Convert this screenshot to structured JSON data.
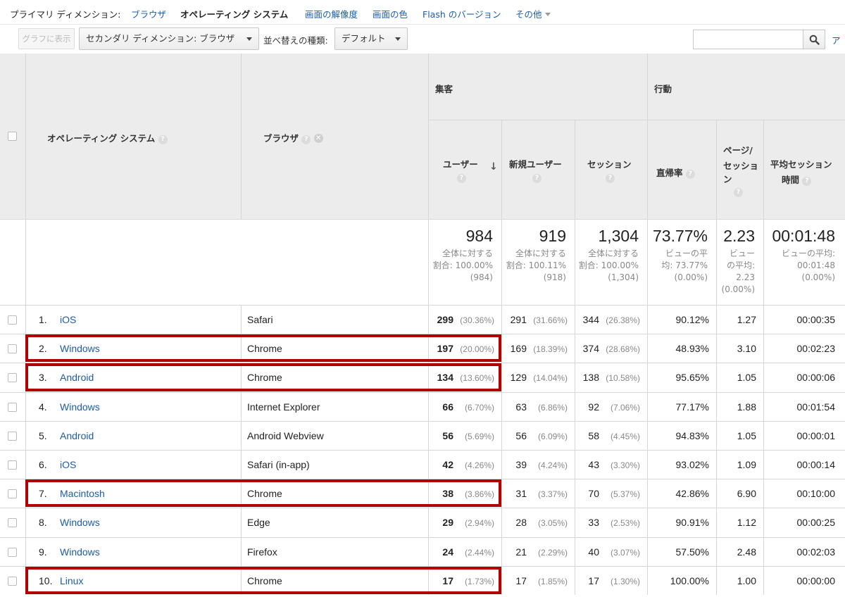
{
  "dimension_bar": {
    "label": "プライマリ ディメンション:",
    "options": [
      "ブラウザ",
      "オペレーティング システム",
      "画面の解像度",
      "画面の色",
      "Flash のバージョン",
      "その他"
    ],
    "active": "オペレーティング システム"
  },
  "toolbar": {
    "plot_button": "グラフに表示",
    "secondary_dimension": "セカンダリ ディメンション: ブラウザ",
    "sort_label": "並べ替えの種類:",
    "sort_value": "デフォルト",
    "search_value": "",
    "advanced_link": "ア"
  },
  "table": {
    "headers": {
      "os": "オペレーティング システム",
      "browser": "ブラウザ",
      "acquisition": "集客",
      "behavior": "行動",
      "users": "ユーザー",
      "new_users": "新規ユーザー",
      "sessions": "セッション",
      "bounce_rate": "直帰率",
      "pages_per_session_1": "ページ/",
      "pages_per_session_2": "セッション",
      "avg_session_1": "平均セッション",
      "avg_session_2": "時間",
      "help_glyph": "?",
      "remove_glyph": "✕",
      "sort_glyph": "↓"
    },
    "summary": {
      "users": {
        "value": "984",
        "l1": "全体に対する",
        "l2": "割合: 100.00%",
        "l3": "(984)"
      },
      "new_users": {
        "value": "919",
        "l1": "全体に対する",
        "l2": "割合: 100.11%",
        "l3": "(918)"
      },
      "sessions": {
        "value": "1,304",
        "l1": "全体に対する",
        "l2": "割合: 100.00%",
        "l3": "(1,304)"
      },
      "bounce_rate": {
        "value": "73.77%",
        "l1": "ビューの平",
        "l2": "均: 73.77%",
        "l3": "(0.00%)"
      },
      "pages": {
        "value": "2.23",
        "l1": "ビュー",
        "l2": "の平均:",
        "l3": "2.23",
        "l4": "(0.00%)"
      },
      "avg_duration": {
        "value": "00:01:48",
        "l1": "ビューの平均:",
        "l2": "00:01:48",
        "l3": "(0.00%)"
      }
    },
    "rows": [
      {
        "idx": "1.",
        "os": "iOS",
        "browser": "Safari",
        "users": "299",
        "users_pct": "(30.36%)",
        "new_users": "291",
        "new_users_pct": "(31.66%)",
        "sessions": "344",
        "sessions_pct": "(26.38%)",
        "bounce": "90.12%",
        "pages": "1.27",
        "duration": "00:00:35"
      },
      {
        "idx": "2.",
        "os": "Windows",
        "browser": "Chrome",
        "users": "197",
        "users_pct": "(20.00%)",
        "new_users": "169",
        "new_users_pct": "(18.39%)",
        "sessions": "374",
        "sessions_pct": "(28.68%)",
        "bounce": "48.93%",
        "pages": "3.10",
        "duration": "00:02:23"
      },
      {
        "idx": "3.",
        "os": "Android",
        "browser": "Chrome",
        "users": "134",
        "users_pct": "(13.60%)",
        "new_users": "129",
        "new_users_pct": "(14.04%)",
        "sessions": "138",
        "sessions_pct": "(10.58%)",
        "bounce": "95.65%",
        "pages": "1.05",
        "duration": "00:00:06"
      },
      {
        "idx": "4.",
        "os": "Windows",
        "browser": "Internet Explorer",
        "users": "66",
        "users_pct": "(6.70%)",
        "new_users": "63",
        "new_users_pct": "(6.86%)",
        "sessions": "92",
        "sessions_pct": "(7.06%)",
        "bounce": "77.17%",
        "pages": "1.88",
        "duration": "00:01:54"
      },
      {
        "idx": "5.",
        "os": "Android",
        "browser": "Android Webview",
        "users": "56",
        "users_pct": "(5.69%)",
        "new_users": "56",
        "new_users_pct": "(6.09%)",
        "sessions": "58",
        "sessions_pct": "(4.45%)",
        "bounce": "94.83%",
        "pages": "1.05",
        "duration": "00:00:01"
      },
      {
        "idx": "6.",
        "os": "iOS",
        "browser": "Safari (in-app)",
        "users": "42",
        "users_pct": "(4.26%)",
        "new_users": "39",
        "new_users_pct": "(4.24%)",
        "sessions": "43",
        "sessions_pct": "(3.30%)",
        "bounce": "93.02%",
        "pages": "1.09",
        "duration": "00:00:14"
      },
      {
        "idx": "7.",
        "os": "Macintosh",
        "browser": "Chrome",
        "users": "38",
        "users_pct": "(3.86%)",
        "new_users": "31",
        "new_users_pct": "(3.37%)",
        "sessions": "70",
        "sessions_pct": "(5.37%)",
        "bounce": "42.86%",
        "pages": "6.90",
        "duration": "00:10:00"
      },
      {
        "idx": "8.",
        "os": "Windows",
        "browser": "Edge",
        "users": "29",
        "users_pct": "(2.94%)",
        "new_users": "28",
        "new_users_pct": "(3.05%)",
        "sessions": "33",
        "sessions_pct": "(2.53%)",
        "bounce": "90.91%",
        "pages": "1.12",
        "duration": "00:00:25"
      },
      {
        "idx": "9.",
        "os": "Windows",
        "browser": "Firefox",
        "users": "24",
        "users_pct": "(2.44%)",
        "new_users": "21",
        "new_users_pct": "(2.29%)",
        "sessions": "40",
        "sessions_pct": "(3.07%)",
        "bounce": "57.50%",
        "pages": "2.48",
        "duration": "00:02:03"
      },
      {
        "idx": "10.",
        "os": "Linux",
        "browser": "Chrome",
        "users": "17",
        "users_pct": "(1.73%)",
        "new_users": "17",
        "new_users_pct": "(1.85%)",
        "sessions": "17",
        "sessions_pct": "(1.30%)",
        "bounce": "100.00%",
        "pages": "1.00",
        "duration": "00:00:00"
      }
    ],
    "highlighted_rows": [
      2,
      3,
      7,
      10
    ]
  },
  "colors": {
    "link": "#1d5ca8",
    "highlight": "#b00000",
    "header_bg": "#ececec"
  }
}
